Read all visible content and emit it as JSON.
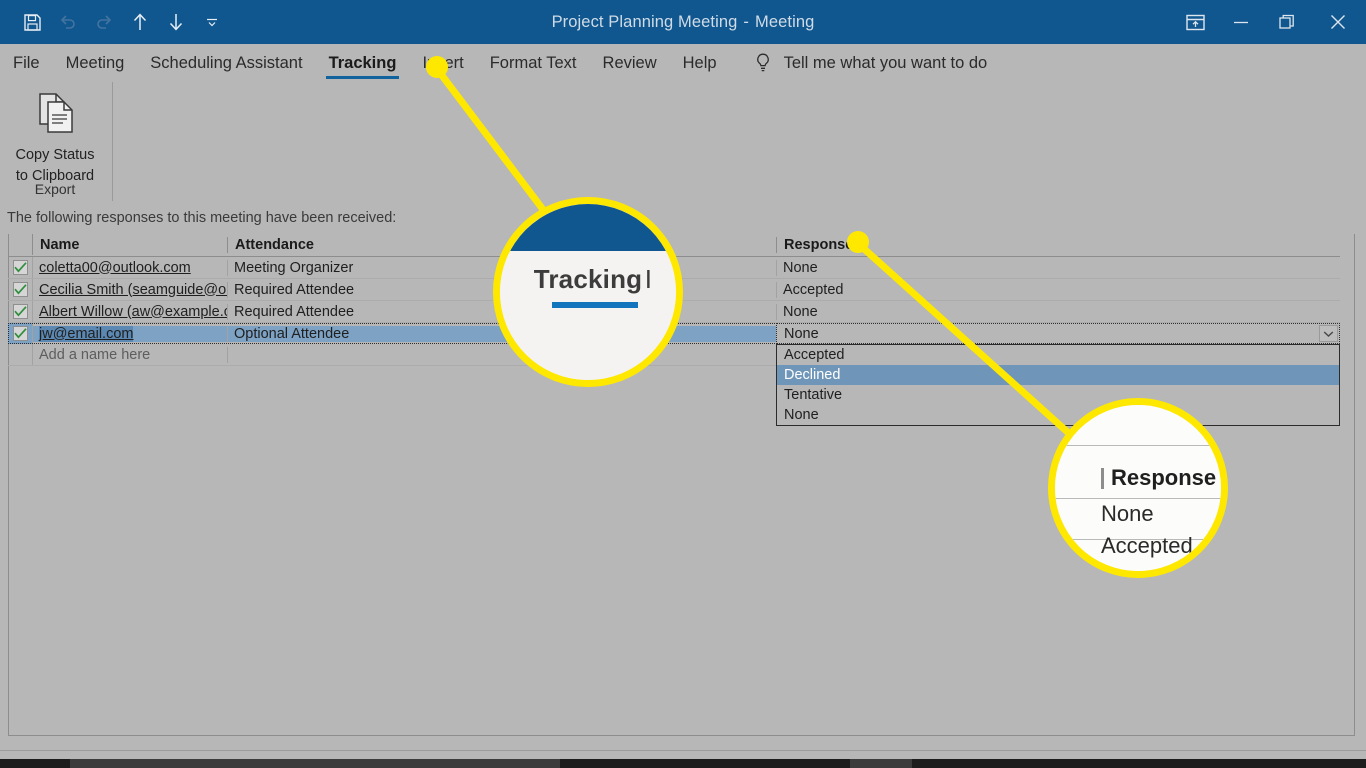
{
  "window": {
    "title": "Project Planning Meeting",
    "title_separator": "-",
    "title_suffix": "Meeting",
    "quick_access": [
      {
        "name": "save-icon",
        "label": "Save"
      },
      {
        "name": "undo-icon",
        "label": "Undo"
      },
      {
        "name": "redo-icon",
        "label": "Redo"
      },
      {
        "name": "previous-item-icon",
        "label": "Previous Item"
      },
      {
        "name": "next-item-icon",
        "label": "Next Item"
      },
      {
        "name": "customize-quick-access-toolbar-icon",
        "label": "Customize Quick Access Toolbar"
      }
    ],
    "controls": [
      {
        "name": "ribbon-display-options-icon",
        "label": "Ribbon Display Options"
      },
      {
        "name": "minimize-icon",
        "label": "Minimize"
      },
      {
        "name": "restore-icon",
        "label": "Restore Down"
      },
      {
        "name": "close-icon",
        "label": "Close"
      }
    ]
  },
  "ribbon": {
    "tabs": [
      {
        "label": "File",
        "active": false
      },
      {
        "label": "Meeting",
        "active": false
      },
      {
        "label": "Scheduling Assistant",
        "active": false
      },
      {
        "label": "Tracking",
        "active": true
      },
      {
        "label": "Insert",
        "active": false
      },
      {
        "label": "Format Text",
        "active": false
      },
      {
        "label": "Review",
        "active": false
      },
      {
        "label": "Help",
        "active": false
      }
    ],
    "tell_me": "Tell me what you want to do",
    "tell_me_icon": "lightbulb-icon",
    "export_group": {
      "button_line1": "Copy Status",
      "button_line2": "to Clipboard",
      "button_icon": "copy-status-to-clipboard-icon",
      "group_label": "Export"
    },
    "collapse_icon": "chevron-up-icon"
  },
  "content": {
    "note": "The following responses to this meeting have been received:",
    "columns": [
      "",
      "Name",
      "Attendance",
      "Response"
    ],
    "rows": [
      {
        "checked": true,
        "name": "coletta00@outlook.com",
        "attendance": "Meeting Organizer",
        "response": "None",
        "selected": false
      },
      {
        "checked": true,
        "name": "Cecilia Smith (seamguide@outlo",
        "attendance": "Required Attendee",
        "response": "Accepted",
        "selected": false
      },
      {
        "checked": true,
        "name": "Albert Willow (aw@example.com",
        "attendance": "Required Attendee",
        "response": "None",
        "selected": false
      },
      {
        "checked": true,
        "name": "jw@email.com",
        "attendance": "Optional Attendee",
        "response": "None",
        "selected": true
      }
    ],
    "placeholder_row": "Add a name here",
    "response_dropdown": {
      "value": "None",
      "arrow_icon": "chevron-down-icon",
      "options": [
        {
          "label": "Accepted",
          "highlighted": false
        },
        {
          "label": "Declined",
          "highlighted": true
        },
        {
          "label": "Tentative",
          "highlighted": false
        },
        {
          "label": "None",
          "highlighted": false
        }
      ]
    }
  },
  "callouts": {
    "magnifier_tracking": {
      "word": "Tracking",
      "next_letter": "I"
    },
    "magnifier_response": {
      "header": "Response",
      "row1": "None",
      "row2": "Accepted"
    },
    "accent_color": "#ffe800"
  }
}
